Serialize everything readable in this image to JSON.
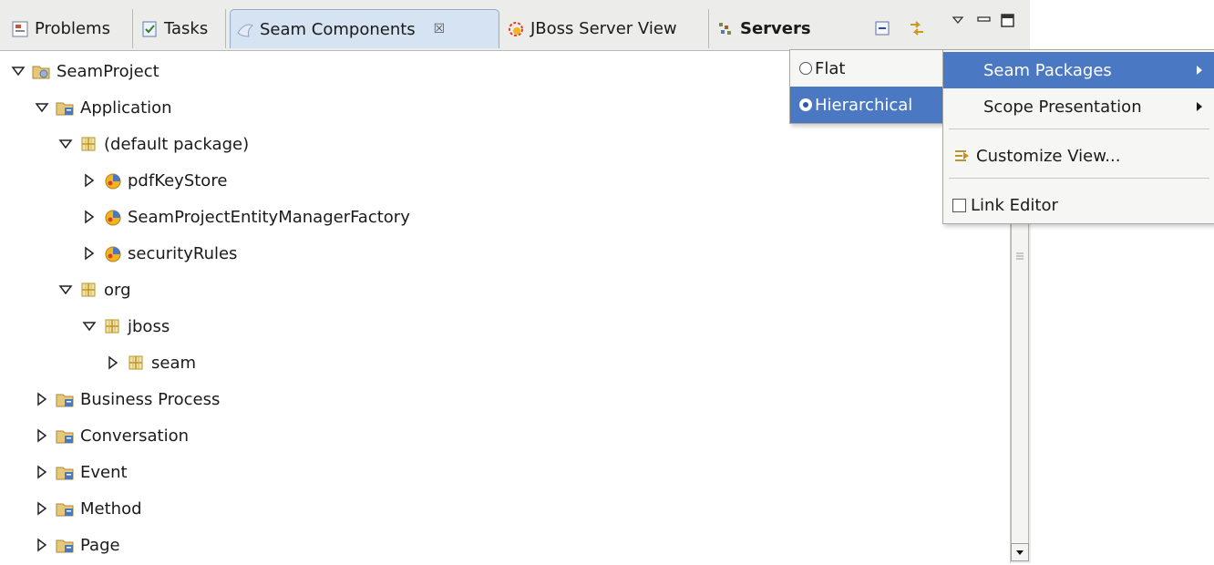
{
  "tabs": [
    {
      "label": "Problems",
      "icon": "problems-icon"
    },
    {
      "label": "Tasks",
      "icon": "tasks-icon"
    },
    {
      "label": "Seam Components",
      "icon": "seam-components-icon",
      "active": true,
      "close": "☒"
    },
    {
      "label": "JBoss Server View",
      "icon": "jboss-server-icon"
    },
    {
      "label": "Servers",
      "icon": "servers-icon",
      "bold": true
    }
  ],
  "toolbar": {
    "collapse_icon": "collapse-all-icon",
    "link_icon": "link-with-editor-icon",
    "menu_icon": "view-menu-icon",
    "minimize_icon": "minimize-icon",
    "maximize_icon": "maximize-icon"
  },
  "tree": [
    {
      "label": "SeamProject",
      "depth": 0,
      "expanded": true,
      "icon": "project-icon"
    },
    {
      "label": "Application",
      "depth": 1,
      "expanded": true,
      "icon": "scope-folder-icon"
    },
    {
      "label": "(default package)",
      "depth": 2,
      "expanded": true,
      "icon": "package-icon"
    },
    {
      "label": "pdfKeyStore",
      "depth": 3,
      "expanded": false,
      "icon": "component-icon"
    },
    {
      "label": "SeamProjectEntityManagerFactory",
      "depth": 3,
      "expanded": false,
      "icon": "component-icon"
    },
    {
      "label": "securityRules",
      "depth": 3,
      "expanded": false,
      "icon": "component-icon"
    },
    {
      "label": "org",
      "depth": 2,
      "expanded": true,
      "icon": "package-icon"
    },
    {
      "label": "jboss",
      "depth": 3,
      "expanded": true,
      "icon": "package-icon"
    },
    {
      "label": "seam",
      "depth": 4,
      "expanded": false,
      "icon": "package-icon"
    },
    {
      "label": "Business Process",
      "depth": 1,
      "expanded": false,
      "icon": "scope-folder-icon"
    },
    {
      "label": "Conversation",
      "depth": 1,
      "expanded": false,
      "icon": "scope-folder-icon"
    },
    {
      "label": "Event",
      "depth": 1,
      "expanded": false,
      "icon": "scope-folder-icon"
    },
    {
      "label": "Method",
      "depth": 1,
      "expanded": false,
      "icon": "scope-folder-icon"
    },
    {
      "label": "Page",
      "depth": 1,
      "expanded": false,
      "icon": "scope-folder-icon"
    }
  ],
  "submenu": {
    "items": [
      {
        "label": "Flat",
        "selected": false
      },
      {
        "label": "Hierarchical",
        "selected": true
      }
    ]
  },
  "view_menu": {
    "seam_packages": "Seam Packages",
    "scope_presentation": "Scope Presentation",
    "customize_view": "Customize View...",
    "link_editor": "Link Editor",
    "link_editor_checked": false
  },
  "colors": {
    "menu_highlight": "#4a78c2",
    "active_tab": "#d6e3f2",
    "package_icon": "#b8962e"
  }
}
